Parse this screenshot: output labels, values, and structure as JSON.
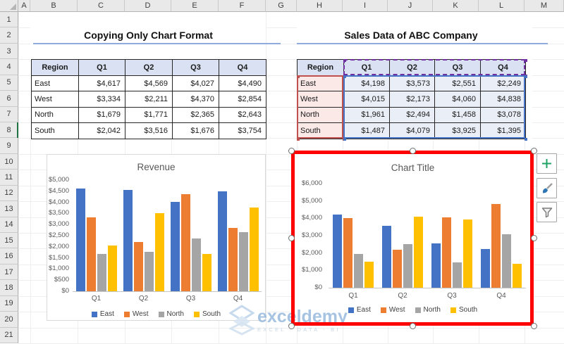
{
  "spreadsheet": {
    "columns": [
      "A",
      "B",
      "C",
      "D",
      "E",
      "F",
      "G",
      "H",
      "I",
      "J",
      "K",
      "L",
      "M"
    ],
    "rows": [
      "1",
      "2",
      "3",
      "4",
      "5",
      "6",
      "7",
      "8",
      "9",
      "10",
      "11",
      "12",
      "13",
      "14",
      "15",
      "16",
      "17",
      "18",
      "19",
      "20",
      "21"
    ],
    "active_row": "8",
    "accent_green": "#217346"
  },
  "left_section": {
    "title": "Copying Only Chart Format",
    "table": {
      "headers": [
        "Region",
        "Q1",
        "Q2",
        "Q3",
        "Q4"
      ],
      "rows": [
        [
          "East",
          "$4,617",
          "$4,569",
          "$4,027",
          "$4,490"
        ],
        [
          "West",
          "$3,334",
          "$2,211",
          "$4,370",
          "$2,854"
        ],
        [
          "North",
          "$1,679",
          "$1,771",
          "$2,365",
          "$2,643"
        ],
        [
          "South",
          "$2,042",
          "$3,516",
          "$1,676",
          "$3,754"
        ]
      ]
    }
  },
  "right_section": {
    "title": "Sales Data of ABC Company",
    "table": {
      "headers": [
        "Region",
        "Q1",
        "Q2",
        "Q3",
        "Q4"
      ],
      "rows": [
        [
          "East",
          "$4,198",
          "$3,573",
          "$2,551",
          "$2,249"
        ],
        [
          "West",
          "$4,015",
          "$2,173",
          "$4,060",
          "$4,838"
        ],
        [
          "North",
          "$1,961",
          "$2,494",
          "$1,458",
          "$3,078"
        ],
        [
          "South",
          "$1,487",
          "$4,079",
          "$3,925",
          "$1,395"
        ]
      ]
    },
    "highlight": {
      "series_names_border": "#7030a0",
      "categories_border": "#c0504d",
      "categories_fill": "#fbe9e8",
      "values_border": "#4472c4",
      "values_fill": "#e9eef7"
    }
  },
  "chart_data": [
    {
      "type": "bar",
      "title": "Revenue",
      "categories": [
        "Q1",
        "Q2",
        "Q3",
        "Q4"
      ],
      "series": [
        {
          "name": "East",
          "color": "#4472c4",
          "values": [
            4617,
            4569,
            4027,
            4490
          ]
        },
        {
          "name": "West",
          "color": "#ed7d31",
          "values": [
            3334,
            2211,
            4370,
            2854
          ]
        },
        {
          "name": "North",
          "color": "#a5a5a5",
          "values": [
            1679,
            1771,
            2365,
            2643
          ]
        },
        {
          "name": "South",
          "color": "#ffc000",
          "values": [
            2042,
            3516,
            1676,
            3754
          ]
        }
      ],
      "ylim": [
        0,
        5000
      ],
      "ytick_step": 500,
      "ytick_labels": [
        "$0",
        "$500",
        "$1,000",
        "$1,500",
        "$2,000",
        "$2,500",
        "$3,000",
        "$3,500",
        "$4,000",
        "$4,500",
        "$5,000"
      ],
      "legend_position": "bottom",
      "grid": false
    },
    {
      "type": "bar",
      "title": "Chart Title",
      "categories": [
        "Q1",
        "Q2",
        "Q3",
        "Q4"
      ],
      "series": [
        {
          "name": "East",
          "color": "#4472c4",
          "values": [
            4198,
            3573,
            2551,
            2249
          ]
        },
        {
          "name": "West",
          "color": "#ed7d31",
          "values": [
            4015,
            2173,
            4060,
            4838
          ]
        },
        {
          "name": "North",
          "color": "#a5a5a5",
          "values": [
            1961,
            2494,
            1458,
            3078
          ]
        },
        {
          "name": "South",
          "color": "#ffc000",
          "values": [
            1487,
            4079,
            3925,
            1395
          ]
        }
      ],
      "ylim": [
        0,
        6000
      ],
      "ytick_step": 1000,
      "ytick_labels": [
        "$0",
        "$1,000",
        "$2,000",
        "$3,000",
        "$4,000",
        "$5,000",
        "$6,000"
      ],
      "legend_position": "bottom",
      "grid": false
    }
  ],
  "chart_buttons": [
    {
      "icon": "plus",
      "color": "#21a366"
    },
    {
      "icon": "brush",
      "color": "#2e75b6"
    },
    {
      "icon": "funnel",
      "color": "#7b7b7b"
    }
  ],
  "watermark": {
    "brand": "exceldemy",
    "tagline": "EXCEL - DATA - BI"
  }
}
